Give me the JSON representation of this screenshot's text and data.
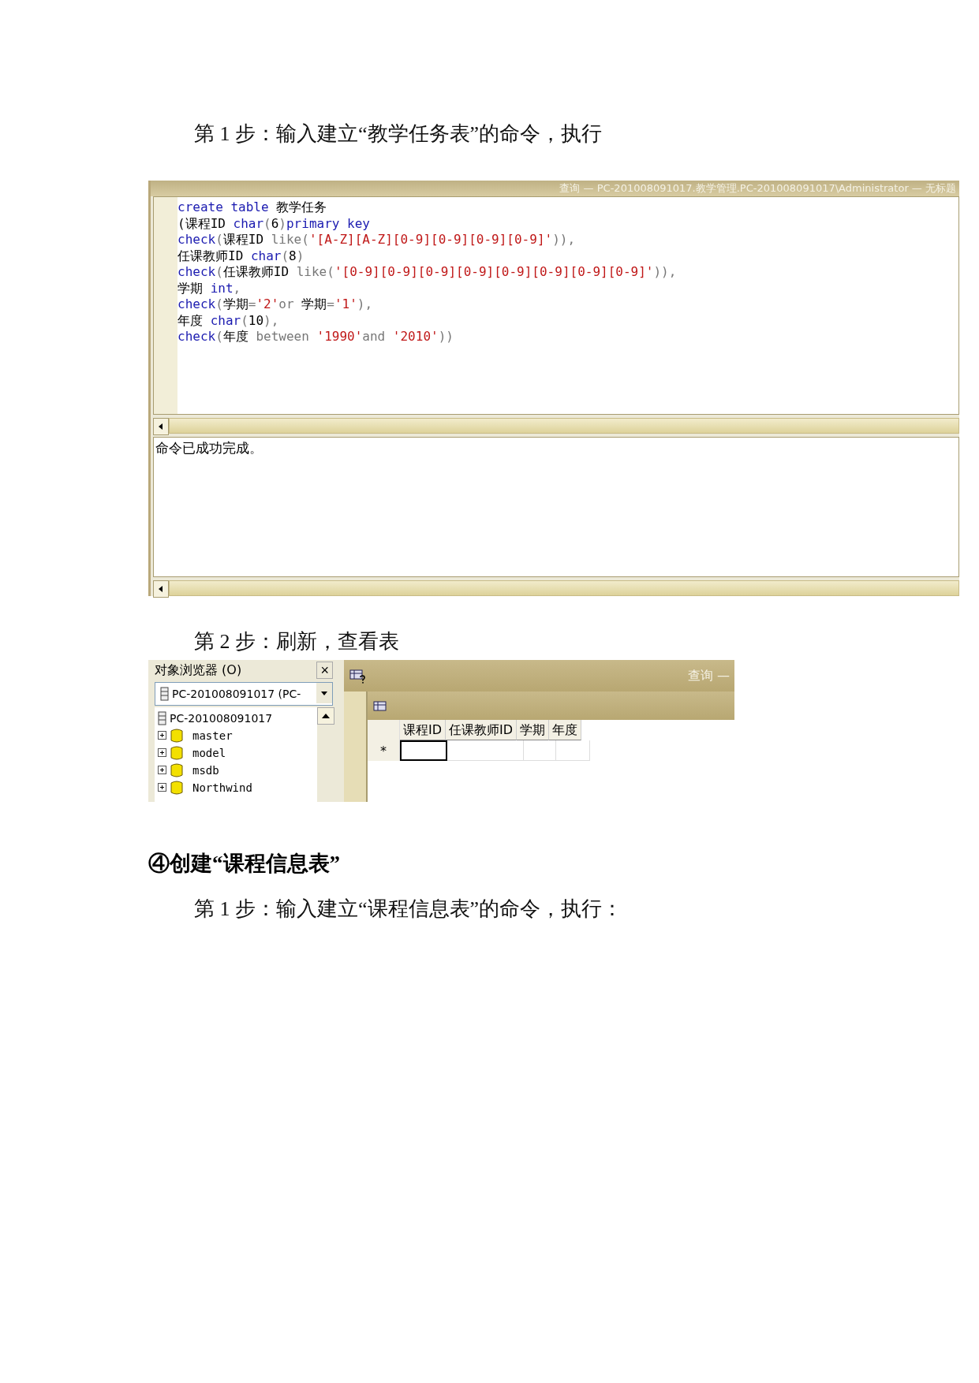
{
  "step_1_heading": "第 1 步：输入建立“教学任务表”的命令，执行",
  "query_window": {
    "title": "查询 — PC-201008091017.教学管理.PC-201008091017\\Administrator — 无标题",
    "code_lines": [
      [
        {
          "kind": "keyword",
          "text": "create table"
        },
        {
          "kind": "text",
          "text": " 教学任务"
        }
      ],
      [
        {
          "kind": "text",
          "text": "(课程ID "
        },
        {
          "kind": "keyword",
          "text": "char"
        },
        {
          "kind": "operator",
          "text": "("
        },
        {
          "kind": "text",
          "text": "6"
        },
        {
          "kind": "operator",
          "text": ")"
        },
        {
          "kind": "keyword",
          "text": "primary key"
        }
      ],
      [
        {
          "kind": "keyword",
          "text": "check"
        },
        {
          "kind": "operator",
          "text": "("
        },
        {
          "kind": "text",
          "text": "课程ID "
        },
        {
          "kind": "operator",
          "text": "like("
        },
        {
          "kind": "string",
          "text": "'[A-Z][A-Z][0-9][0-9][0-9][0-9]'"
        },
        {
          "kind": "operator",
          "text": ")),"
        }
      ],
      [
        {
          "kind": "text",
          "text": "任课教师ID "
        },
        {
          "kind": "keyword",
          "text": "char"
        },
        {
          "kind": "operator",
          "text": "("
        },
        {
          "kind": "text",
          "text": "8"
        },
        {
          "kind": "operator",
          "text": ")"
        }
      ],
      [
        {
          "kind": "keyword",
          "text": "check"
        },
        {
          "kind": "operator",
          "text": "("
        },
        {
          "kind": "text",
          "text": "任课教师ID "
        },
        {
          "kind": "operator",
          "text": "like("
        },
        {
          "kind": "string",
          "text": "'[0-9][0-9][0-9][0-9][0-9][0-9][0-9][0-9]'"
        },
        {
          "kind": "operator",
          "text": ")),"
        }
      ],
      [
        {
          "kind": "text",
          "text": "学期 "
        },
        {
          "kind": "keyword",
          "text": "int"
        },
        {
          "kind": "operator",
          "text": ","
        }
      ],
      [
        {
          "kind": "keyword",
          "text": "check"
        },
        {
          "kind": "operator",
          "text": "("
        },
        {
          "kind": "text",
          "text": "学期"
        },
        {
          "kind": "operator",
          "text": "="
        },
        {
          "kind": "string",
          "text": "'2'"
        },
        {
          "kind": "operator",
          "text": "or "
        },
        {
          "kind": "text",
          "text": "学期"
        },
        {
          "kind": "operator",
          "text": "="
        },
        {
          "kind": "string",
          "text": "'1'"
        },
        {
          "kind": "operator",
          "text": "),"
        }
      ],
      [
        {
          "kind": "text",
          "text": "年度 "
        },
        {
          "kind": "keyword",
          "text": "char"
        },
        {
          "kind": "operator",
          "text": "("
        },
        {
          "kind": "text",
          "text": "10"
        },
        {
          "kind": "operator",
          "text": "),"
        }
      ],
      [
        {
          "kind": "keyword",
          "text": "check"
        },
        {
          "kind": "operator",
          "text": "("
        },
        {
          "kind": "text",
          "text": "年度 "
        },
        {
          "kind": "operator",
          "text": "between "
        },
        {
          "kind": "string",
          "text": "'1990'"
        },
        {
          "kind": "operator",
          "text": "and "
        },
        {
          "kind": "string",
          "text": "'2010'"
        },
        {
          "kind": "operator",
          "text": "))"
        }
      ]
    ],
    "result_message": "命令已成功完成。"
  },
  "step_2_heading": "第 2 步：刷新，查看表",
  "object_browser": {
    "title": "对象浏览器 (O)",
    "close": "×",
    "server_selector": "PC-201008091017 (PC-",
    "tree": {
      "label": "PC-201008091017",
      "children": [
        {
          "label": "master",
          "expanded": false
        },
        {
          "label": "model",
          "expanded": false
        },
        {
          "label": "msdb",
          "expanded": false
        },
        {
          "label": "Northwind",
          "expanded": false
        }
      ]
    }
  },
  "table_window": {
    "title": "查询 —",
    "columns": [
      "课程ID",
      "任课教师ID",
      "学期",
      "年度"
    ],
    "new_row_marker": "*"
  },
  "section_heading": "④创建“课程信息表”",
  "step_1b_heading": "第 1 步：输入建立“课程信息表”的命令，执行："
}
